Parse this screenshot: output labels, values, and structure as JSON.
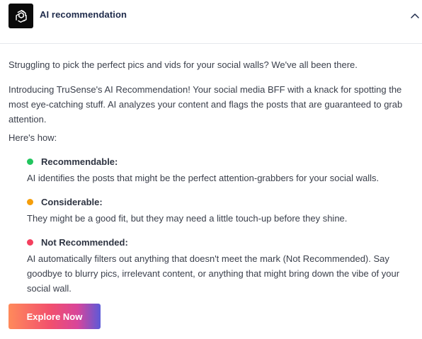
{
  "header": {
    "title": "AI recommendation",
    "logo_icon": "openai-knot-icon",
    "collapse_icon": "chevron-up-icon"
  },
  "intro": {
    "p1": "Struggling to pick the perfect pics and vids for your social walls? We've all been there.",
    "p2": "Introducing TruSense's AI Recommendation! Your social media BFF with a knack for spotting the most eye-catching stuff. AI analyzes your content and flags the posts that are guaranteed to grab attention.",
    "p3": "Here's how:"
  },
  "items": [
    {
      "title": "Recommendable:",
      "description": "AI identifies the posts that might be the perfect attention-grabbers for your social walls.",
      "color": "#22c55e"
    },
    {
      "title": "Considerable:",
      "description": "They might be a good fit, but they may need a little touch-up before they shine.",
      "color": "#f59e0b"
    },
    {
      "title": "Not Recommended:",
      "description": "AI automatically filters out anything that doesn't meet the mark (Not Recommended). Say goodbye to blurry pics, irrelevant content, or anything that might bring down the vibe of your social wall.",
      "color": "#f43f5e"
    }
  ],
  "cta": {
    "label": "Explore Now"
  }
}
